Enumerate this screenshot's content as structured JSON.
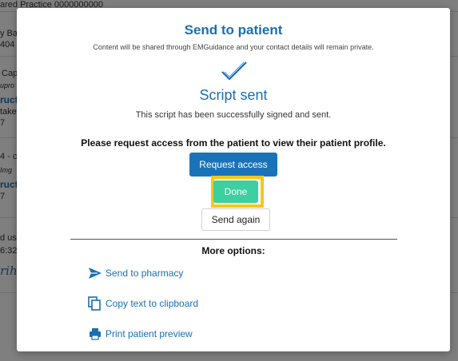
{
  "background": {
    "practice_text": "ared Practice  0000000000",
    "left_fragments": [
      "y Ba",
      "404",
      "Cap",
      "upro",
      "ructi",
      "take",
      "7",
      "4 - c",
      "Img",
      "ructi",
      "7",
      "d usi",
      "6:32",
      "rih"
    ]
  },
  "modal": {
    "title": "Send to patient",
    "subtitle": "Content will be shared through EMGuidance and your contact details will remain private.",
    "sent_title": "Script sent",
    "sent_message": "This script has been successfully signed and sent.",
    "request_message": "Please request access from the patient to view their patient profile.",
    "buttons": {
      "request_access": "Request access",
      "done": "Done",
      "send_again": "Send again"
    },
    "more_options_title": "More options:",
    "options": [
      {
        "label": "Send to pharmacy",
        "icon": "send-icon"
      },
      {
        "label": "Copy text to clipboard",
        "icon": "copy-icon"
      },
      {
        "label": "Print patient preview",
        "icon": "print-icon"
      }
    ]
  },
  "colors": {
    "accent_blue": "#1a6fb3",
    "done_green": "#3ccf9f",
    "highlight_yellow": "#f7c815"
  }
}
